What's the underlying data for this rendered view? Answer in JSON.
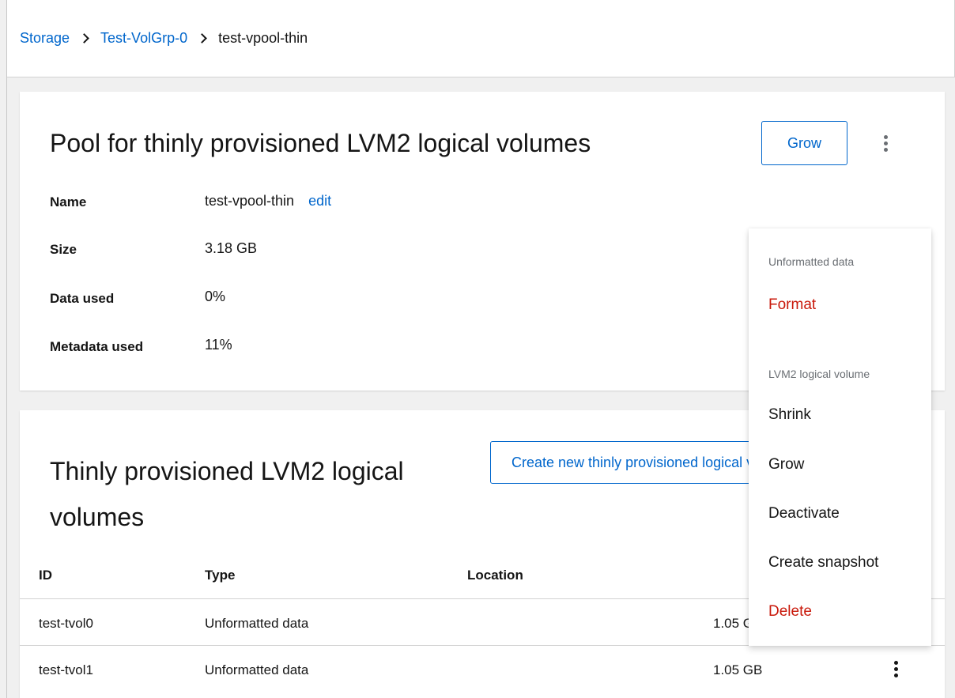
{
  "breadcrumb": {
    "items": [
      "Storage",
      "Test-VolGrp-0"
    ],
    "current": "test-vpool-thin"
  },
  "pool_card": {
    "title": "Pool for thinly provisioned LVM2 logical volumes",
    "grow_label": "Grow",
    "fields": [
      {
        "label": "Name",
        "value": "test-vpool-thin",
        "action": "edit"
      },
      {
        "label": "Size",
        "value": "3.18 GB"
      },
      {
        "label": "Data used",
        "value": "0%"
      },
      {
        "label": "Metadata used",
        "value": "11%"
      }
    ]
  },
  "volumes_card": {
    "title": "Thinly provisioned LVM2 logical volumes",
    "create_label": "Create new thinly provisioned logical volume",
    "columns": [
      "ID",
      "Type",
      "Location"
    ],
    "rows": [
      {
        "id": "test-tvol0",
        "type": "Unformatted data",
        "size": "1.05 GB"
      },
      {
        "id": "test-tvol1",
        "type": "Unformatted data",
        "size": "1.05 GB"
      }
    ]
  },
  "menu": {
    "groups": [
      {
        "title": "Unformatted data",
        "items": [
          "Format"
        ]
      },
      {
        "title": "LVM2 logical volume",
        "items": [
          "Shrink",
          "Grow",
          "Deactivate",
          "Create snapshot",
          "Delete"
        ]
      }
    ]
  },
  "icons": {
    "breadcrumb_separator": "chevron-right-icon",
    "kebab": "kebab-menu-icon"
  },
  "colors": {
    "link": "#0066cc",
    "danger": "#c9190b",
    "muted": "#6a6e73"
  }
}
